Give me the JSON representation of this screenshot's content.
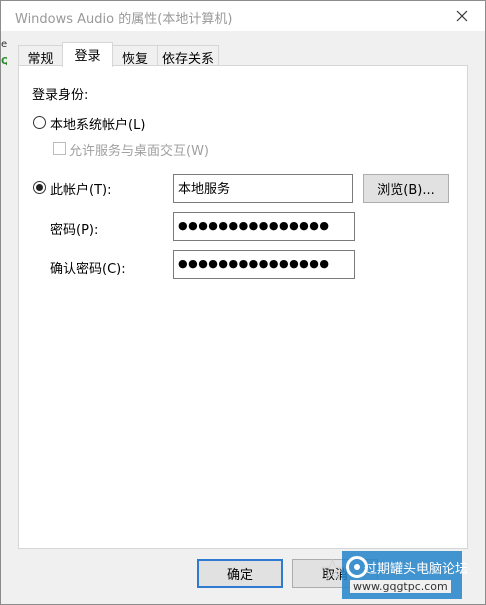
{
  "window": {
    "title": "Windows Audio 的属性(本地计算机)"
  },
  "background_fragments": [
    "e(",
    "Q"
  ],
  "tabs": [
    {
      "label": "常规",
      "active": false
    },
    {
      "label": "登录",
      "active": true
    },
    {
      "label": "恢复",
      "active": false
    },
    {
      "label": "依存关系",
      "active": false
    }
  ],
  "logon": {
    "section_label": "登录身份:",
    "local_system_label": "本地系统帐户(L)",
    "allow_desktop_label": "允许服务与桌面交互(W)",
    "this_account_label": "此帐户(T):",
    "account_value": "本地服务",
    "browse_label": "浏览(B)...",
    "password_label": "密码(P):",
    "password_value": "●●●●●●●●●●●●●●●",
    "confirm_label": "确认密码(C):",
    "confirm_value": "●●●●●●●●●●●●●●●",
    "selected_option": "this_account"
  },
  "footer": {
    "ok_label": "确定",
    "cancel_label": "取消"
  },
  "watermark": {
    "text": "过期罐头电脑论坛",
    "url": "www.gqgtpc.com"
  },
  "colors": {
    "accent": "#2f7bd1",
    "disabled_text": "#a0a0a0",
    "watermark_bg": "#2284c9"
  }
}
